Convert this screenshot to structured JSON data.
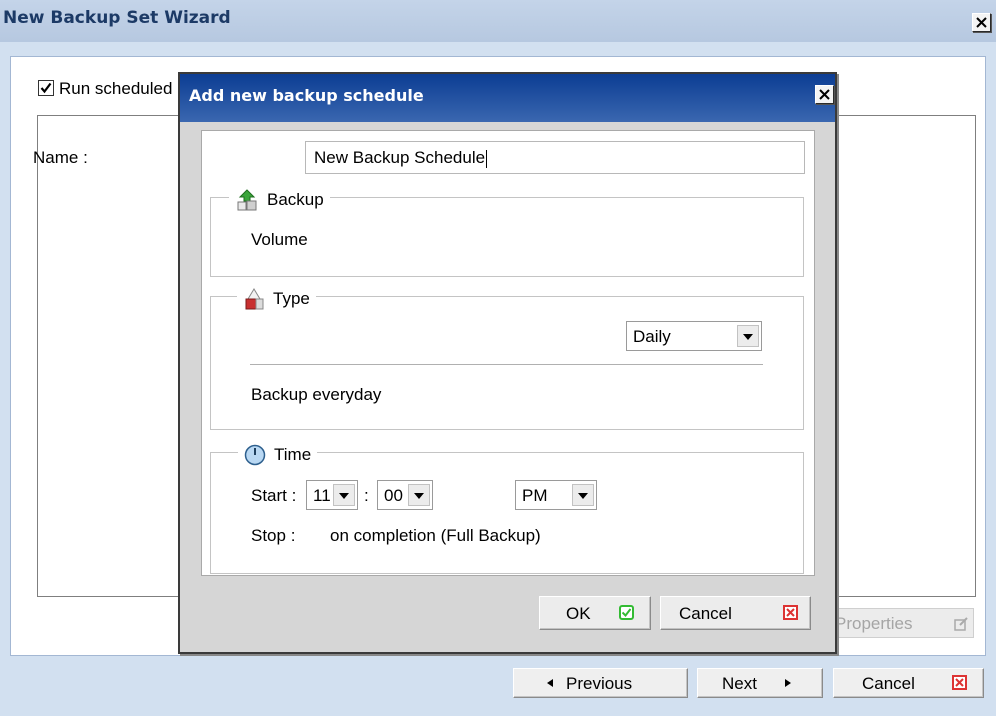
{
  "window": {
    "title": "New Backup Set Wizard"
  },
  "schedule_panel": {
    "run_label": "Run scheduled backup for backup set",
    "run_checked": true,
    "properties_label": "Properties"
  },
  "nav": {
    "previous": "Previous",
    "next": "Next",
    "cancel": "Cancel"
  },
  "dialog": {
    "title": "Add new backup schedule",
    "name_label": "Name :",
    "name_value": "New Backup Schedule",
    "backup": {
      "legend": "Backup",
      "value": "Volume"
    },
    "type": {
      "legend": "Type",
      "selected": "Daily",
      "description": "Backup everyday"
    },
    "time": {
      "legend": "Time",
      "start_label": "Start :",
      "hour": "11",
      "colon": ":",
      "minute": "00",
      "ampm": "PM",
      "stop_label": "Stop :",
      "stop_value": "on completion (Full Backup)"
    },
    "ok": "OK",
    "cancel": "Cancel"
  },
  "colors": {
    "dialog_title_bg": "#0c3d93",
    "window_bg": "#d2e0f0",
    "ok_icon": "#33bb33",
    "cancel_icon": "#dd3333"
  },
  "icons": [
    "close-icon",
    "check-icon",
    "backup-upload-icon",
    "type-icon",
    "clock-icon",
    "ok-icon",
    "cancel-x-icon",
    "edit-icon",
    "arrow-left-icon",
    "arrow-right-icon",
    "chevron-down-icon"
  ]
}
